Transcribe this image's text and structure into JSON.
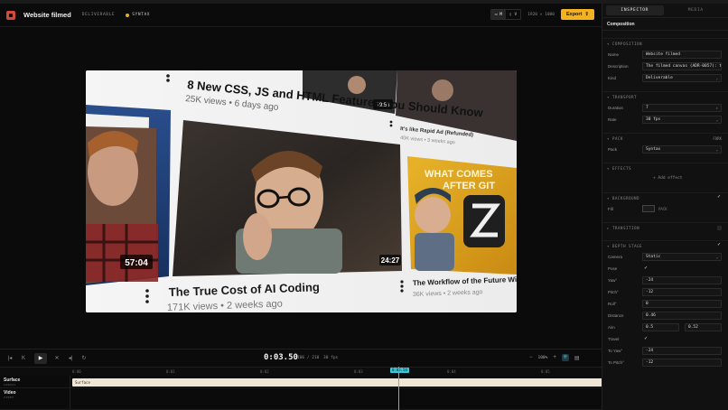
{
  "header": {
    "title": "Website filmed",
    "kind_badge": "DELIVERABLE",
    "pack_badge": "SYNTAX",
    "view_seg": [
      "M",
      "V"
    ],
    "resolution": "1920 × 1080",
    "export_label": "Export"
  },
  "canvas": {
    "video_top_title": "8 New CSS, JS and HTML Features You Should Know",
    "video_top_meta": "25K views • 6 days ago",
    "video_tr_title": "It's like Rapid Ad (Refunded)",
    "video_tr_meta": "40K views • 3 weeks ago",
    "video_tr_duration": "19:58",
    "video_left_duration": "57:04",
    "video_main_title": "The True Cost of AI Coding",
    "video_main_meta": "171K views • 2 weeks ago",
    "video_main_duration": "24:27",
    "video_right_thumb_text": [
      "WHAT COMES",
      "AFTER GIT"
    ],
    "video_right_title": "The Workflow of the Future With Zed",
    "video_right_meta": "36K views • 2 weeks ago"
  },
  "inspector": {
    "tabs": [
      "INSPECTOR",
      "MEDIA"
    ],
    "heading": "Composition",
    "sections": {
      "composition": "COMPOSITION",
      "transport": "TRANSPORT",
      "pack": "PACK",
      "pack_fork": "FORK",
      "effects": "EFFECTS",
      "add_effect": "+ Add effect",
      "background": "BACKGROUND",
      "transition": "TRANSITION",
      "depth_stage": "DEPTH STAGE"
    },
    "fields": {
      "name_label": "Name",
      "name_value": "Website filmed",
      "description_label": "Description",
      "description_value": "The filmed canvas (ADR-0057): th",
      "kind_label": "Kind",
      "kind_value": "Deliverable",
      "duration_label": "Duration",
      "duration_value": "7",
      "rate_label": "Rate",
      "rate_value": "30 fps",
      "pack_label": "Pack",
      "pack_value": "Syntax",
      "fill_label": "Fill",
      "fill_value": "PACK",
      "camera_label": "Camera",
      "camera_value": "Static",
      "pose_label": "Pose",
      "yaw_label": "Yaw°",
      "yaw_value": "-24",
      "pitch_label": "Pitch°",
      "pitch_value": "-12",
      "roll_label": "Roll°",
      "roll_value": "0",
      "distance_label": "Distance",
      "distance_value": "0.46",
      "aim_label": "Aim",
      "aim_x": "0.5",
      "aim_y": "0.52",
      "travel_label": "Travel",
      "to_yaw_label": "To Yaw°",
      "to_yaw_value": "-24",
      "to_pitch_label": "To Pitch°",
      "to_pitch_value": "-12"
    }
  },
  "transport": {
    "timecode": "0:03.50",
    "frames": "106 / 210",
    "fps": "30 fps",
    "zoom": "100%"
  },
  "timeline": {
    "ticks": [
      "0:00",
      "0:01",
      "0:02",
      "0:03",
      "0:04",
      "0:05",
      "0:06"
    ],
    "playhead_label": "0:03.50",
    "tracks": [
      {
        "name": "Surface",
        "sub": "CANVAS",
        "clip": "Surface"
      },
      {
        "name": "Video",
        "sub": "VIDEO"
      }
    ]
  },
  "colors": {
    "accent": "#f3b31e",
    "playhead": "#3ec6d8",
    "clip": "#efe6d7"
  }
}
